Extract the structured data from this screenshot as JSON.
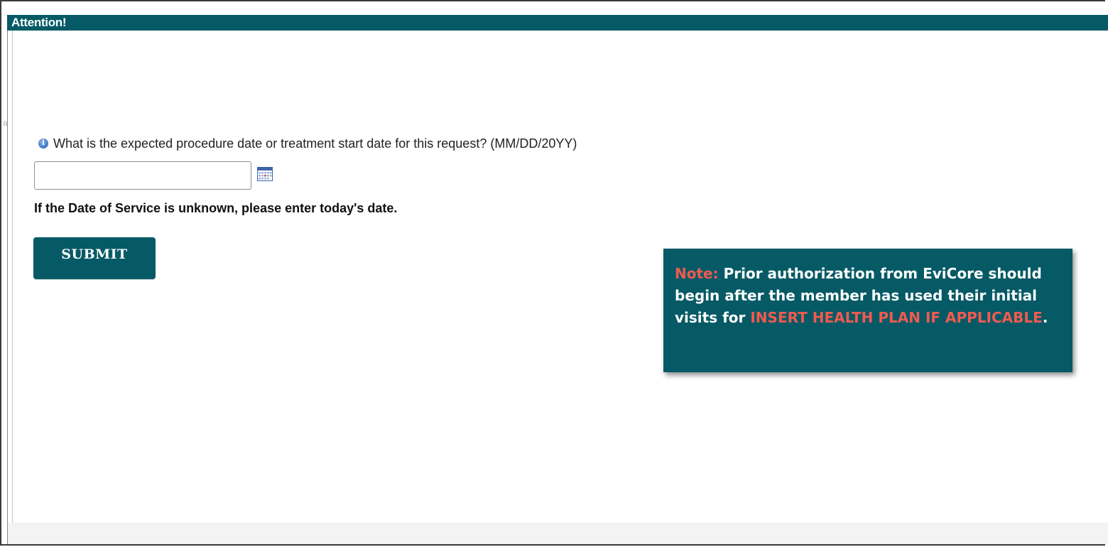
{
  "header": {
    "title": "Attention!"
  },
  "question": {
    "icon": "info-icon",
    "text": "What is the expected procedure date or treatment start date for this request? (MM/DD/20YY)"
  },
  "date_field": {
    "value": "",
    "placeholder": "",
    "calendar_icon": "calendar-icon"
  },
  "dos_note": "If the Date of Service is unknown, please enter today's date.",
  "submit": {
    "label": "SUBMIT"
  },
  "callout": {
    "note_label": "Note:",
    "text_main": " Prior authorization from EviCore should begin after the member has used their initial visits for ",
    "highlight": "INSERT HEALTH PLAN IF APPLICABLE",
    "text_end": "."
  },
  "colors": {
    "header_bg": "#065a66",
    "button_bg": "#065a66",
    "callout_bg": "#065a66",
    "accent": "#f05a4f"
  }
}
